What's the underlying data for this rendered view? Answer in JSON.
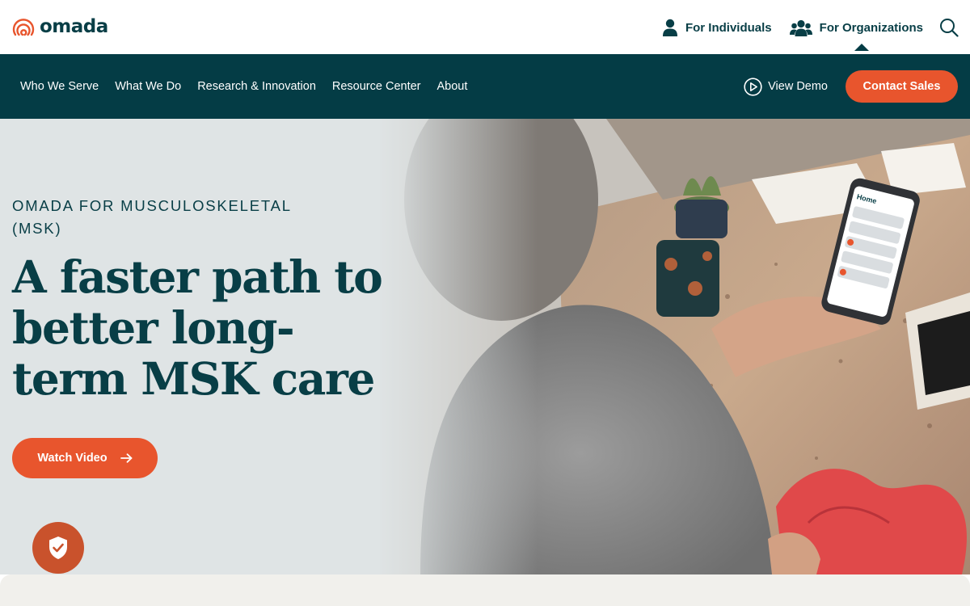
{
  "brand": {
    "name": "omada",
    "accent_color": "#e8552d",
    "primary_color": "#043c45",
    "text_color": "#083e46"
  },
  "utility_nav": {
    "individuals": {
      "label": "For Individuals",
      "icon": "person-icon"
    },
    "organizations": {
      "label": "For Organizations",
      "icon": "group-icon"
    },
    "search": {
      "icon": "search-icon"
    }
  },
  "main_nav": {
    "items": [
      {
        "label": "Who We Serve"
      },
      {
        "label": "What We Do"
      },
      {
        "label": "Research & Innovation"
      },
      {
        "label": "Resource Center"
      },
      {
        "label": "About"
      }
    ],
    "view_demo": {
      "label": "View Demo",
      "icon": "play-circle-icon"
    },
    "contact_sales": {
      "label": "Contact Sales"
    }
  },
  "hero": {
    "eyebrow": "OMADA FOR MUSCULOSKELETAL (MSK)",
    "headline": "A faster path to better long-term MSK care",
    "cta": {
      "label": "Watch Video",
      "icon": "arrow-right-icon"
    },
    "image": "woman-at-counter-holding-phone-with-resistance-band"
  },
  "phone_app": {
    "screen_title": "Home"
  },
  "trust_badge": {
    "icon": "shield-check-icon"
  }
}
